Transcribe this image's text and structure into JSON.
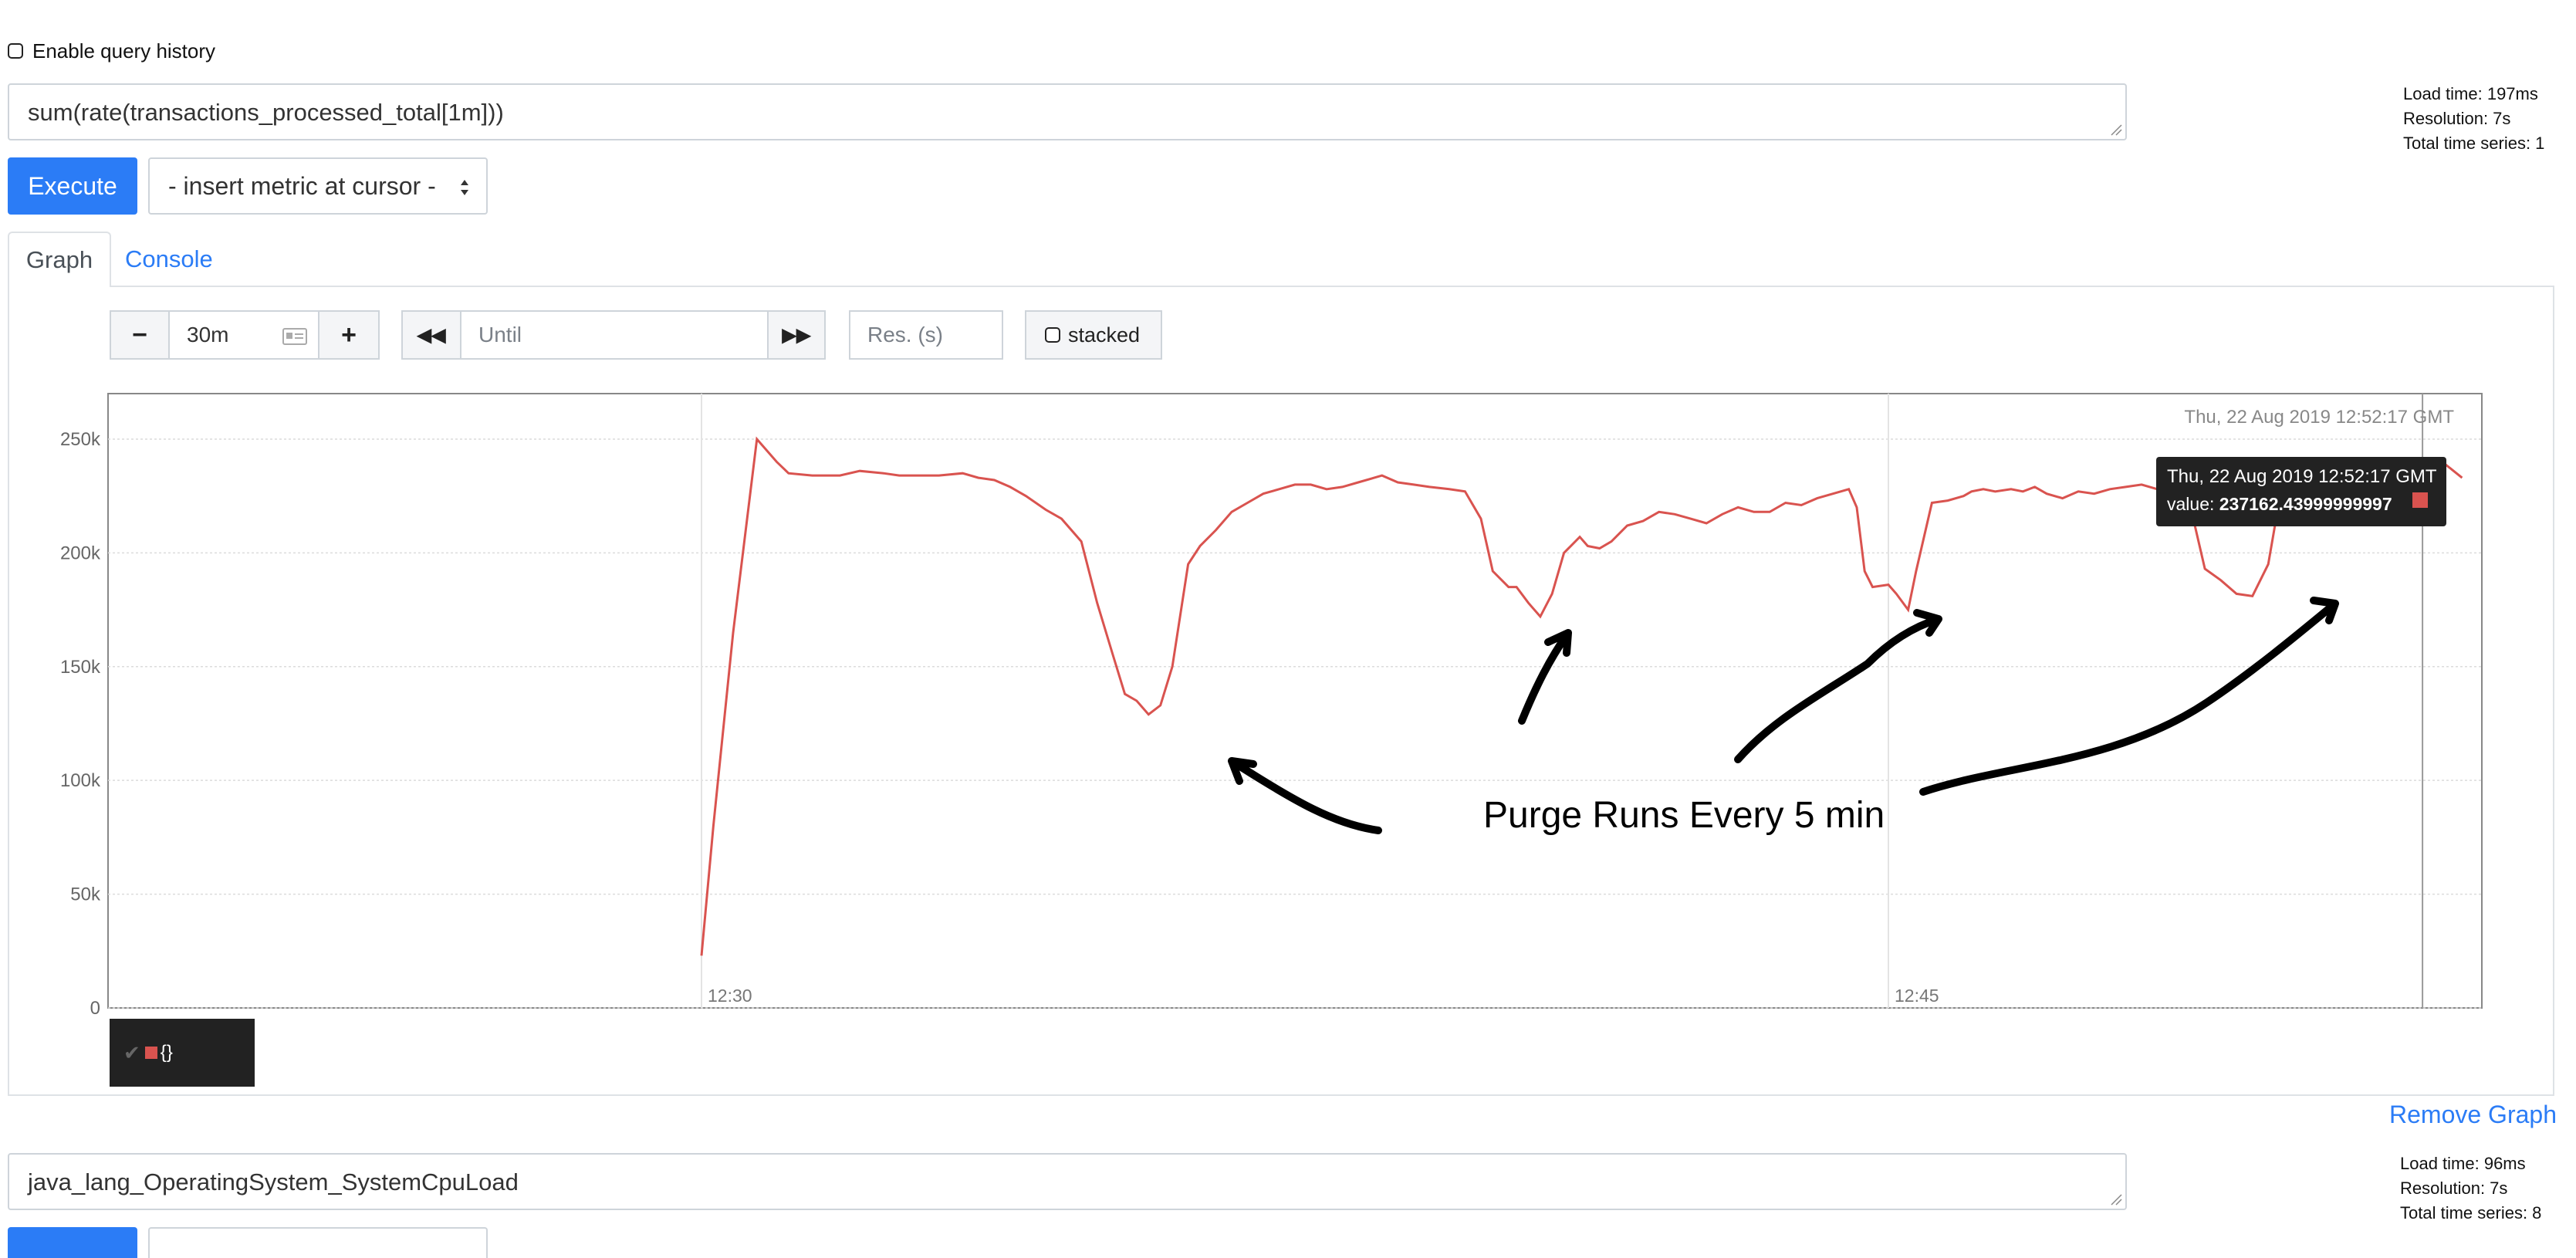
{
  "query_history": {
    "label": "Enable query history",
    "checked": false
  },
  "graph1": {
    "expression": "sum(rate(transactions_processed_total[1m]))",
    "stats": {
      "load_time": "Load time: 197ms",
      "resolution": "Resolution: 7s",
      "total_series": "Total time series: 1"
    },
    "execute_label": "Execute",
    "metric_select": "- insert metric at cursor -",
    "tabs": {
      "graph": "Graph",
      "console": "Console"
    },
    "controls": {
      "minus": "−",
      "range": "30m",
      "plus": "+",
      "back": "◀◀",
      "until_placeholder": "Until",
      "forward": "▶▶",
      "res_placeholder": "Res. (s)",
      "stacked_label": "stacked"
    },
    "legend_label": "{}",
    "remove_label": "Remove Graph",
    "tooltip": {
      "time": "Thu, 22 Aug 2019 12:52:17 GMT",
      "value_label": "value:",
      "value": "237162.43999999997"
    },
    "annotation": "Purge Runs Every 5 min"
  },
  "chart_data": {
    "type": "line",
    "title": "",
    "xlabel": "",
    "ylabel": "",
    "hover_time_label": "Thu, 22 Aug 2019 12:52:17 GMT",
    "y_ticks": [
      "0",
      "50k",
      "100k",
      "150k",
      "200k",
      "250k"
    ],
    "ylim": [
      0,
      270000
    ],
    "x_ticks": [
      {
        "label": "12:30",
        "minute": 30
      },
      {
        "label": "12:45",
        "minute": 45
      }
    ],
    "xlim_minutes": [
      22.5,
      52.5
    ],
    "grid": true,
    "series": [
      {
        "name": "{}",
        "color": "#d9534f",
        "x_minutes": [
          30.0,
          30.15,
          30.4,
          30.7,
          30.95,
          31.1,
          31.4,
          31.55,
          31.75,
          32.0,
          32.3,
          32.5,
          32.8,
          33.0,
          33.3,
          33.5,
          33.7,
          33.9,
          34.1,
          34.35,
          34.55,
          34.8,
          35.0,
          35.2,
          35.35,
          35.5,
          35.65,
          35.8,
          35.95,
          36.15,
          36.3,
          36.5,
          36.7,
          36.9,
          37.1,
          37.3,
          37.5,
          37.7,
          37.9,
          38.1,
          38.3,
          38.6,
          38.8,
          39.0,
          39.2,
          39.45,
          39.65,
          39.85,
          40.0,
          40.2,
          40.3,
          40.45,
          40.6,
          40.75,
          40.9,
          41.1,
          41.2,
          41.35,
          41.5,
          41.7,
          41.9,
          42.1,
          42.3,
          42.5,
          42.7,
          42.9,
          43.1,
          43.3,
          43.5,
          43.7,
          43.9,
          44.1,
          44.3,
          44.5,
          44.6,
          44.7,
          44.8,
          45.0,
          45.1,
          45.25,
          45.35,
          45.55,
          45.75,
          45.95,
          46.05,
          46.2,
          46.35,
          46.55,
          46.7,
          46.85,
          47.0,
          47.2,
          47.4,
          47.6,
          47.8,
          48.0,
          48.2,
          48.4,
          48.6,
          48.8,
          49.0,
          49.2,
          49.4,
          49.6,
          49.8,
          49.95,
          50.1,
          50.3,
          50.5,
          50.6,
          50.75,
          50.9,
          51.05,
          51.3,
          51.55,
          51.75,
          52.0,
          52.25
        ],
        "values": [
          23000,
          80000,
          165000,
          250000,
          240000,
          235000,
          234000,
          234000,
          234000,
          236000,
          235000,
          234000,
          234000,
          234000,
          235000,
          233000,
          232000,
          229000,
          225000,
          219000,
          215000,
          205000,
          178000,
          155000,
          138000,
          135000,
          129000,
          133000,
          150000,
          195000,
          203000,
          210000,
          218000,
          222000,
          226000,
          228000,
          230000,
          230000,
          228000,
          229000,
          231000,
          234000,
          231000,
          230000,
          229000,
          228000,
          227000,
          215000,
          192000,
          185000,
          185000,
          178000,
          172000,
          182000,
          200000,
          207000,
          203000,
          202000,
          205000,
          212000,
          214000,
          218000,
          217000,
          215000,
          213000,
          217000,
          220000,
          218000,
          218000,
          222000,
          221000,
          224000,
          226000,
          228000,
          220000,
          192000,
          185000,
          186000,
          182000,
          175000,
          192000,
          222000,
          223000,
          225000,
          227000,
          228000,
          227000,
          228000,
          227000,
          229000,
          226000,
          224000,
          227000,
          226000,
          228000,
          229000,
          230000,
          228000,
          227000,
          223000,
          193000,
          188000,
          182000,
          181000,
          195000,
          225000,
          230000,
          237000,
          240000,
          236000,
          233000,
          231000,
          232000,
          233000,
          231000,
          237162,
          240000,
          233000
        ]
      }
    ]
  },
  "graph2": {
    "expression": "java_lang_OperatingSystem_SystemCpuLoad",
    "stats": {
      "load_time": "Load time: 96ms",
      "resolution": "Resolution: 7s",
      "total_series": "Total time series: 8"
    }
  }
}
